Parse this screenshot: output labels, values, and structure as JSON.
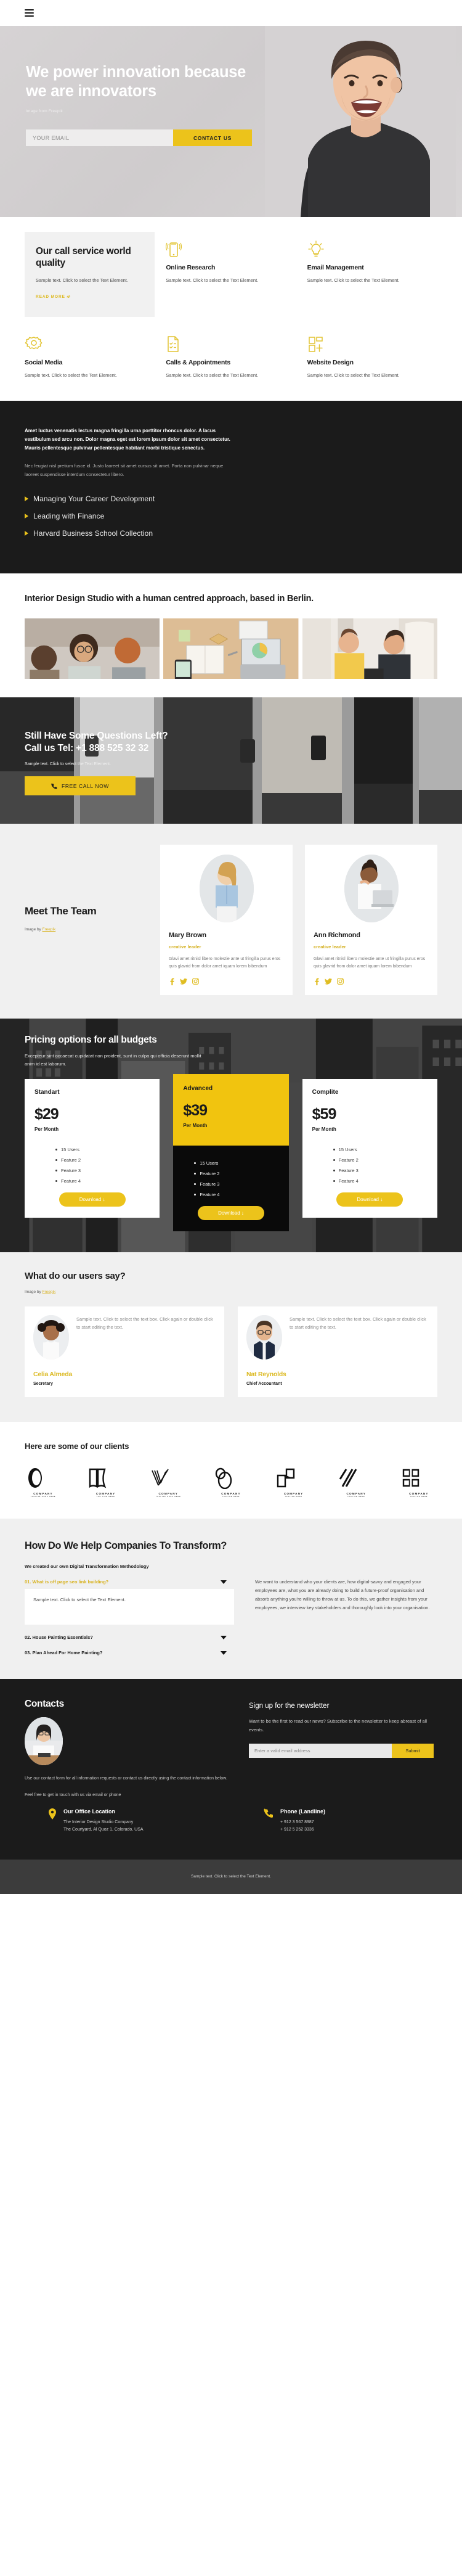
{
  "nav": {
    "menu_label": "menu"
  },
  "hero": {
    "heading": "We power innovation because we are innovators",
    "credit": "Image from Freepik",
    "email_placeholder": "YOUR EMAIL",
    "email_value": "",
    "cta_label": "CONTACT US"
  },
  "services": {
    "feature": {
      "title": "Our call service world quality",
      "text": "Sample text. Click to select the Text Element.",
      "link": "READ MORE"
    },
    "items": [
      {
        "icon": "mobile-phone-icon",
        "title": "Online Research",
        "text": "Sample text. Click to select the Text Element."
      },
      {
        "icon": "lightbulb-icon",
        "title": "Email Management",
        "text": "Sample text. Click to select the Text Element."
      },
      {
        "icon": "gear-icon",
        "title": "Social Media",
        "text": "Sample text. Click to select the Text Element."
      },
      {
        "icon": "checklist-document-icon",
        "title": "Calls & Appointments",
        "text": "Sample text. Click to select the Text Element."
      },
      {
        "icon": "grid-plus-icon",
        "title": "Website Design",
        "text": "Sample text. Click to select the Text Element."
      }
    ]
  },
  "dark": {
    "lead": "Amet luctus venenatis lectus magna fringilla urna porttitor rhoncus dolor. A lacus vestibulum sed arcu non. Dolor magna eget est lorem ipsum dolor sit amet consectetur. Mauris pellentesque pulvinar pellentesque habitant morbi tristique senectus.",
    "sub": "Nec feugiat nisl pretium fusce id. Justo laoreet sit amet cursus sit amet. Porta non pulvinar neque laoreet suspendisse interdum consectetur libero.",
    "list": [
      "Managing Your Career Development",
      "Leading with Finance",
      "Harvard Business School Collection"
    ]
  },
  "interior": {
    "heading": "Interior Design Studio with a human centred approach, based in Berlin.",
    "images": [
      "team-meeting-photo",
      "desk-laptop-notebook-photo",
      "two-women-talking-photo"
    ]
  },
  "cta": {
    "heading_line1": "Still Have Some Questions Left?",
    "heading_line2": "Call us Tel: +1 888 525 32 32",
    "sub": "Sample text. Click to select the Text Element.",
    "button": "FREE CALL NOW"
  },
  "team": {
    "heading": "Meet The Team",
    "credit_prefix": "Image by ",
    "credit_link": "Freepik",
    "members": [
      {
        "name": "Mary Brown",
        "role": "creative leader",
        "desc": "Glavi amet ritnisl libero molestie ante ut fringilla purus eros quis glavrid from dolor amet iquam lorem bibendum",
        "socials": [
          "facebook-icon",
          "twitter-icon",
          "instagram-icon"
        ]
      },
      {
        "name": "Ann Richmond",
        "role": "creative leader",
        "desc": "Glavi amet ritnisl libero molestie ante ut fringilla purus eros quis glavrid from dolor amet iquam lorem bibendum",
        "socials": [
          "facebook-icon",
          "twitter-icon",
          "instagram-icon"
        ]
      }
    ]
  },
  "pricing": {
    "heading": "Pricing options for all budgets",
    "sub": "Excepteur sint occaecat cupidatat non proident, sunt in culpa qui officia deserunt mollit anim id est laborum.",
    "plans": [
      {
        "name": "Standart",
        "price": "$29",
        "period": "Per Month",
        "features": [
          "15 Users",
          "Feature 2",
          "Feature 3",
          "Feature 4"
        ],
        "button": "Download ↓",
        "featured": false
      },
      {
        "name": "Advanced",
        "price": "$39",
        "period": "Per Month",
        "features": [
          "15 Users",
          "Feature 2",
          "Feature 3",
          "Feature 4"
        ],
        "button": "Download ↓",
        "featured": true
      },
      {
        "name": "Complite",
        "price": "$59",
        "period": "Per Month",
        "features": [
          "15 Users",
          "Feature 2",
          "Feature 3",
          "Feature 4"
        ],
        "button": "Download ↓",
        "featured": false
      }
    ]
  },
  "testimonials": {
    "heading": "What do our users say?",
    "credit_prefix": "Image by ",
    "credit_link": "Freepik",
    "items": [
      {
        "text": "Sample text. Click to select the text box. Click again or double click to start editing the text.",
        "name": "Celia Almeda",
        "role": "Secretary"
      },
      {
        "text": "Sample text. Click to select the text box. Click again or double click to start editing the text.",
        "name": "Nat Reynolds",
        "role": "Chief Accountant"
      }
    ]
  },
  "clients": {
    "heading": "Here are some of our clients",
    "logos": [
      {
        "mark": "oval-outline-logo",
        "name": "COMPANY",
        "tagline": "TAGLINE GOES HERE"
      },
      {
        "mark": "open-book-logo",
        "name": "COMPANY",
        "tagline": "TAG LINE HERE"
      },
      {
        "mark": "checkmark-stripes-logo",
        "name": "COMPANY",
        "tagline": "TAGLINE GOES HERE"
      },
      {
        "mark": "double-ellipse-logo",
        "name": "COMPANY",
        "tagline": "TAGLINE HERE"
      },
      {
        "mark": "squares-corner-logo",
        "name": "COMPANY",
        "tagline": "TAGLINE HERE"
      },
      {
        "mark": "diagonal-slashes-logo",
        "name": "COMPANY",
        "tagline": "TAGLINE HERE"
      },
      {
        "mark": "bracket-blocks-logo",
        "name": "COMPANY",
        "tagline": "TAGLINE HERE"
      }
    ]
  },
  "faq": {
    "heading": "How Do We Help Companies To Transform?",
    "method": "We created our own Digital Transformation Methodology",
    "items": [
      {
        "title": "01. What is off page seo link building?",
        "open": true,
        "body": "Sample text. Click to select the Text Element."
      },
      {
        "title": "02. House Painting Essentials?",
        "open": false,
        "body": ""
      },
      {
        "title": "03. Plan Ahead For Home Painting?",
        "open": false,
        "body": ""
      }
    ],
    "right_text": "We want to understand who your clients are, how digital-savvy and engaged your employees are, what you are already doing to build a future-proof organisation and absorb anything you're willing to throw at us. To do this, we gather insights from your employees, we interview key stakeholders and thoroughly look into your organisation."
  },
  "contacts": {
    "heading": "Contacts",
    "text1": "Use our contact form for all information requests or contact us directly using the contact information below.",
    "text2": "Feel free to get in touch with us via email or phone",
    "newsletter_title": "Sign up for the newsletter",
    "newsletter_text": "Want to be the first to read our news? Subscribe to the newsletter to keep abreast of all events.",
    "email_placeholder": "Enter a valid email address",
    "email_value": "",
    "submit_label": "Submit",
    "office": {
      "icon": "location-pin-icon",
      "title": "Our Office Location",
      "line1": "The Interior Design Studio Company",
      "line2": "The Courtyard, Al Quoz 1, Colorado,  USA"
    },
    "phone": {
      "icon": "phone-icon",
      "title": "Phone (Landline)",
      "line1": "+ 912 3 567 8987",
      "line2": "+ 912 5 252 3336"
    }
  },
  "footer": {
    "text": "Sample text. Click to select the Text Element."
  },
  "colors": {
    "accent": "#ecc31b",
    "dark": "#1b1b1b",
    "light": "#f0f0f0"
  }
}
